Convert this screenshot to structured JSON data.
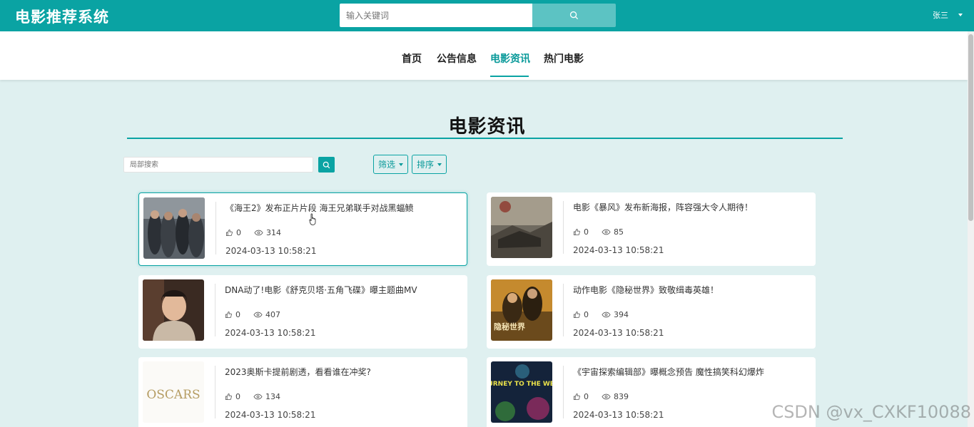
{
  "header": {
    "app_title": "电影推荐系统",
    "search_placeholder": "输入关键词",
    "user_name": "张三"
  },
  "nav": {
    "items": [
      {
        "label": "首页"
      },
      {
        "label": "公告信息"
      },
      {
        "label": "电影资讯",
        "active": true
      },
      {
        "label": "热门电影"
      }
    ]
  },
  "page": {
    "section_title": "电影资讯",
    "local_search_placeholder": "局部搜索",
    "filter_label": "筛选",
    "sort_label": "排序"
  },
  "news": [
    {
      "title": "《海王2》发布正片片段 海王兄弟联手对战黑蝠鲼",
      "likes": "0",
      "views": "314",
      "date": "2024-03-13 10:58:21",
      "thumb": "aquaman-group"
    },
    {
      "title": "电影《暴风》发布新海报，阵容强大令人期待！",
      "likes": "0",
      "views": "85",
      "date": "2024-03-13 10:58:21",
      "thumb": "storm-poster"
    },
    {
      "title": "DNA动了!电影《舒克贝塔·五角飞碟》曝主题曲MV",
      "likes": "0",
      "views": "407",
      "date": "2024-03-13 10:58:21",
      "thumb": "singer-portrait"
    },
    {
      "title": "动作电影《隐秘世界》致敬缉毒英雄！",
      "likes": "0",
      "views": "394",
      "date": "2024-03-13 10:58:21",
      "thumb": "hidden-world-poster",
      "poster_text": "隐秘世界"
    },
    {
      "title": "2023奥斯卡提前剧透，看看谁在冲奖?",
      "likes": "0",
      "views": "134",
      "date": "2024-03-13 10:58:21",
      "thumb": "oscars-logo",
      "poster_text": "OSCARS"
    },
    {
      "title": "《宇宙探索编辑部》曝概念预告 魔性搞笑科幻爆炸",
      "likes": "0",
      "views": "839",
      "date": "2024-03-13 10:58:21",
      "thumb": "journey-west-poster",
      "poster_text": "JOURNEY TO THE WEST"
    }
  ],
  "watermark": "CSDN @vx_CXKF10088",
  "colors": {
    "accent": "#0aa3a3",
    "background": "#dff0f0"
  }
}
